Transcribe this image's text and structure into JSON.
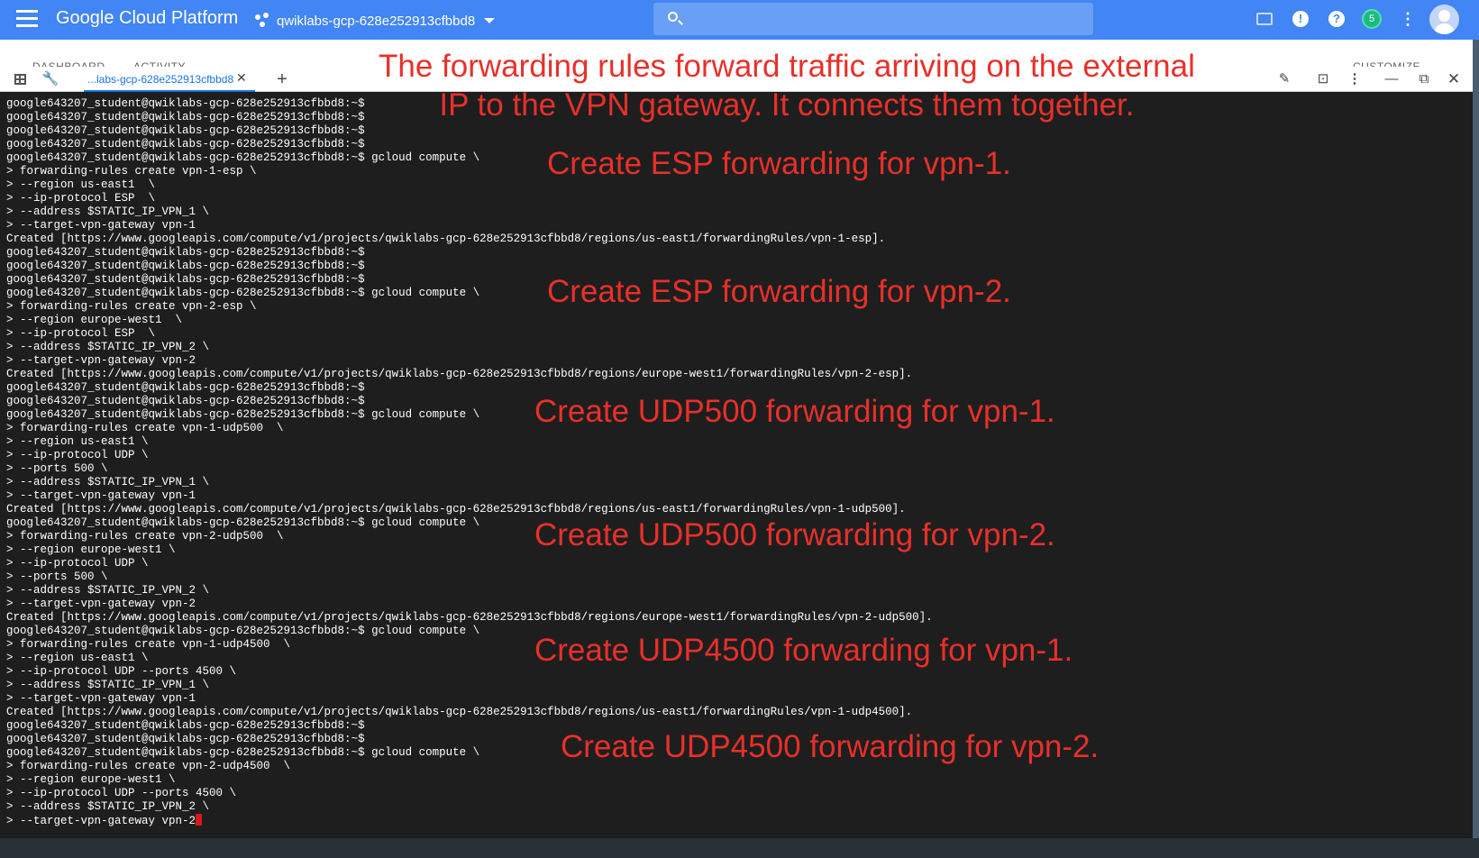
{
  "header": {
    "brand": "Google Cloud Platform",
    "project": "qwiklabs-gcp-628e252913cfbbd8",
    "badge_count": "5"
  },
  "page_tabs": [
    "DASHBOARD",
    "ACTIVITY",
    "CUSTOMIZE"
  ],
  "shell": {
    "tab_label": "...labs-gcp-628e252913cfbbd8",
    "tab_close": "✕",
    "add_tab": "+"
  },
  "terminal_lines": [
    "google643207_student@qwiklabs-gcp-628e252913cfbbd8:~$",
    "google643207_student@qwiklabs-gcp-628e252913cfbbd8:~$",
    "google643207_student@qwiklabs-gcp-628e252913cfbbd8:~$",
    "google643207_student@qwiklabs-gcp-628e252913cfbbd8:~$",
    "google643207_student@qwiklabs-gcp-628e252913cfbbd8:~$ gcloud compute \\",
    "> forwarding-rules create vpn-1-esp \\",
    "> --region us-east1  \\",
    "> --ip-protocol ESP  \\",
    "> --address $STATIC_IP_VPN_1 \\",
    "> --target-vpn-gateway vpn-1",
    "Created [https://www.googleapis.com/compute/v1/projects/qwiklabs-gcp-628e252913cfbbd8/regions/us-east1/forwardingRules/vpn-1-esp].",
    "google643207_student@qwiklabs-gcp-628e252913cfbbd8:~$",
    "google643207_student@qwiklabs-gcp-628e252913cfbbd8:~$",
    "google643207_student@qwiklabs-gcp-628e252913cfbbd8:~$",
    "google643207_student@qwiklabs-gcp-628e252913cfbbd8:~$ gcloud compute \\",
    "> forwarding-rules create vpn-2-esp \\",
    "> --region europe-west1  \\",
    "> --ip-protocol ESP  \\",
    "> --address $STATIC_IP_VPN_2 \\",
    "> --target-vpn-gateway vpn-2",
    "Created [https://www.googleapis.com/compute/v1/projects/qwiklabs-gcp-628e252913cfbbd8/regions/europe-west1/forwardingRules/vpn-2-esp].",
    "google643207_student@qwiklabs-gcp-628e252913cfbbd8:~$",
    "google643207_student@qwiklabs-gcp-628e252913cfbbd8:~$",
    "google643207_student@qwiklabs-gcp-628e252913cfbbd8:~$ gcloud compute \\",
    "> forwarding-rules create vpn-1-udp500  \\",
    "> --region us-east1 \\",
    "> --ip-protocol UDP \\",
    "> --ports 500 \\",
    "> --address $STATIC_IP_VPN_1 \\",
    "> --target-vpn-gateway vpn-1",
    "Created [https://www.googleapis.com/compute/v1/projects/qwiklabs-gcp-628e252913cfbbd8/regions/us-east1/forwardingRules/vpn-1-udp500].",
    "google643207_student@qwiklabs-gcp-628e252913cfbbd8:~$ gcloud compute \\",
    "> forwarding-rules create vpn-2-udp500  \\",
    "> --region europe-west1 \\",
    "> --ip-protocol UDP \\",
    "> --ports 500 \\",
    "> --address $STATIC_IP_VPN_2 \\",
    "> --target-vpn-gateway vpn-2",
    "Created [https://www.googleapis.com/compute/v1/projects/qwiklabs-gcp-628e252913cfbbd8/regions/europe-west1/forwardingRules/vpn-2-udp500].",
    "google643207_student@qwiklabs-gcp-628e252913cfbbd8:~$ gcloud compute \\",
    "> forwarding-rules create vpn-1-udp4500  \\",
    "> --region us-east1 \\",
    "> --ip-protocol UDP --ports 4500 \\",
    "> --address $STATIC_IP_VPN_1 \\",
    "> --target-vpn-gateway vpn-1",
    "Created [https://www.googleapis.com/compute/v1/projects/qwiklabs-gcp-628e252913cfbbd8/regions/us-east1/forwardingRules/vpn-1-udp4500].",
    "google643207_student@qwiklabs-gcp-628e252913cfbbd8:~$",
    "google643207_student@qwiklabs-gcp-628e252913cfbbd8:~$",
    "google643207_student@qwiklabs-gcp-628e252913cfbbd8:~$ gcloud compute \\",
    "> forwarding-rules create vpn-2-udp4500  \\",
    "> --region europe-west1 \\",
    "> --ip-protocol UDP --ports 4500 \\",
    "> --address $STATIC_IP_VPN_2 \\",
    "> --target-vpn-gateway vpn-2"
  ],
  "annotations": {
    "main_line1": "The forwarding rules forward traffic arriving on the external",
    "main_line2": "IP to the VPN gateway. It connects them together.",
    "esp_vpn1": "Create ESP forwarding for vpn-1.",
    "esp_vpn2": "Create ESP forwarding for vpn-2.",
    "udp500_vpn1": "Create UDP500 forwarding for vpn-1.",
    "udp500_vpn2": "Create UDP500 forwarding for vpn-2.",
    "udp4500_vpn1": "Create UDP4500 forwarding for vpn-1.",
    "udp4500_vpn2": "Create UDP4500 forwarding for vpn-2."
  },
  "colors": {
    "app_bar": "#4285f4",
    "terminal_bg": "#1e1e1e",
    "annotation": "#e8302a",
    "cursor": "#d61a1a"
  }
}
